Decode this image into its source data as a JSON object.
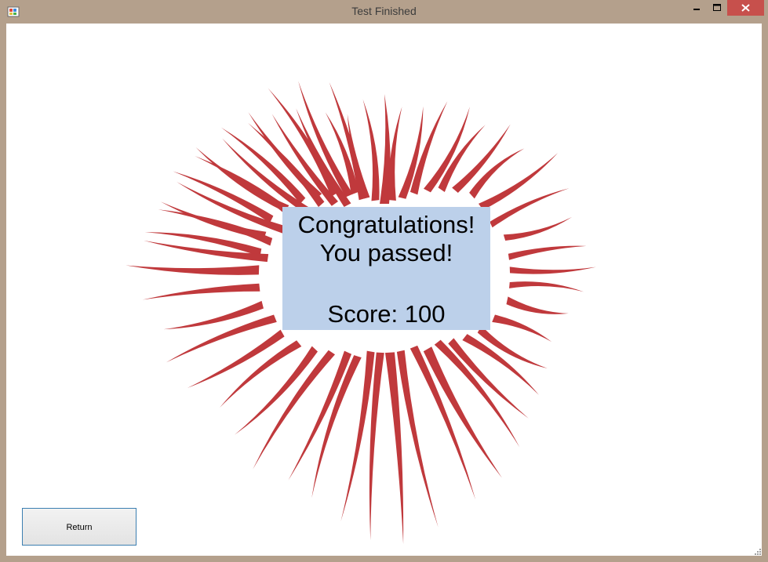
{
  "window": {
    "title": "Test Finished",
    "icons": {
      "app": "app-icon",
      "minimize": "minimize-icon",
      "maximize": "maximize-icon",
      "close": "close-icon"
    },
    "colors": {
      "frame": "#b4a08c",
      "close_button": "#c7504c",
      "client": "#ffffff"
    }
  },
  "result": {
    "line1": "Congratulations!",
    "line2": "You passed!",
    "line3": "Score: 100",
    "colors": {
      "panel": "#bcd0ea",
      "burst": "#c0393c"
    }
  },
  "footer": {
    "return_label": "Return"
  }
}
